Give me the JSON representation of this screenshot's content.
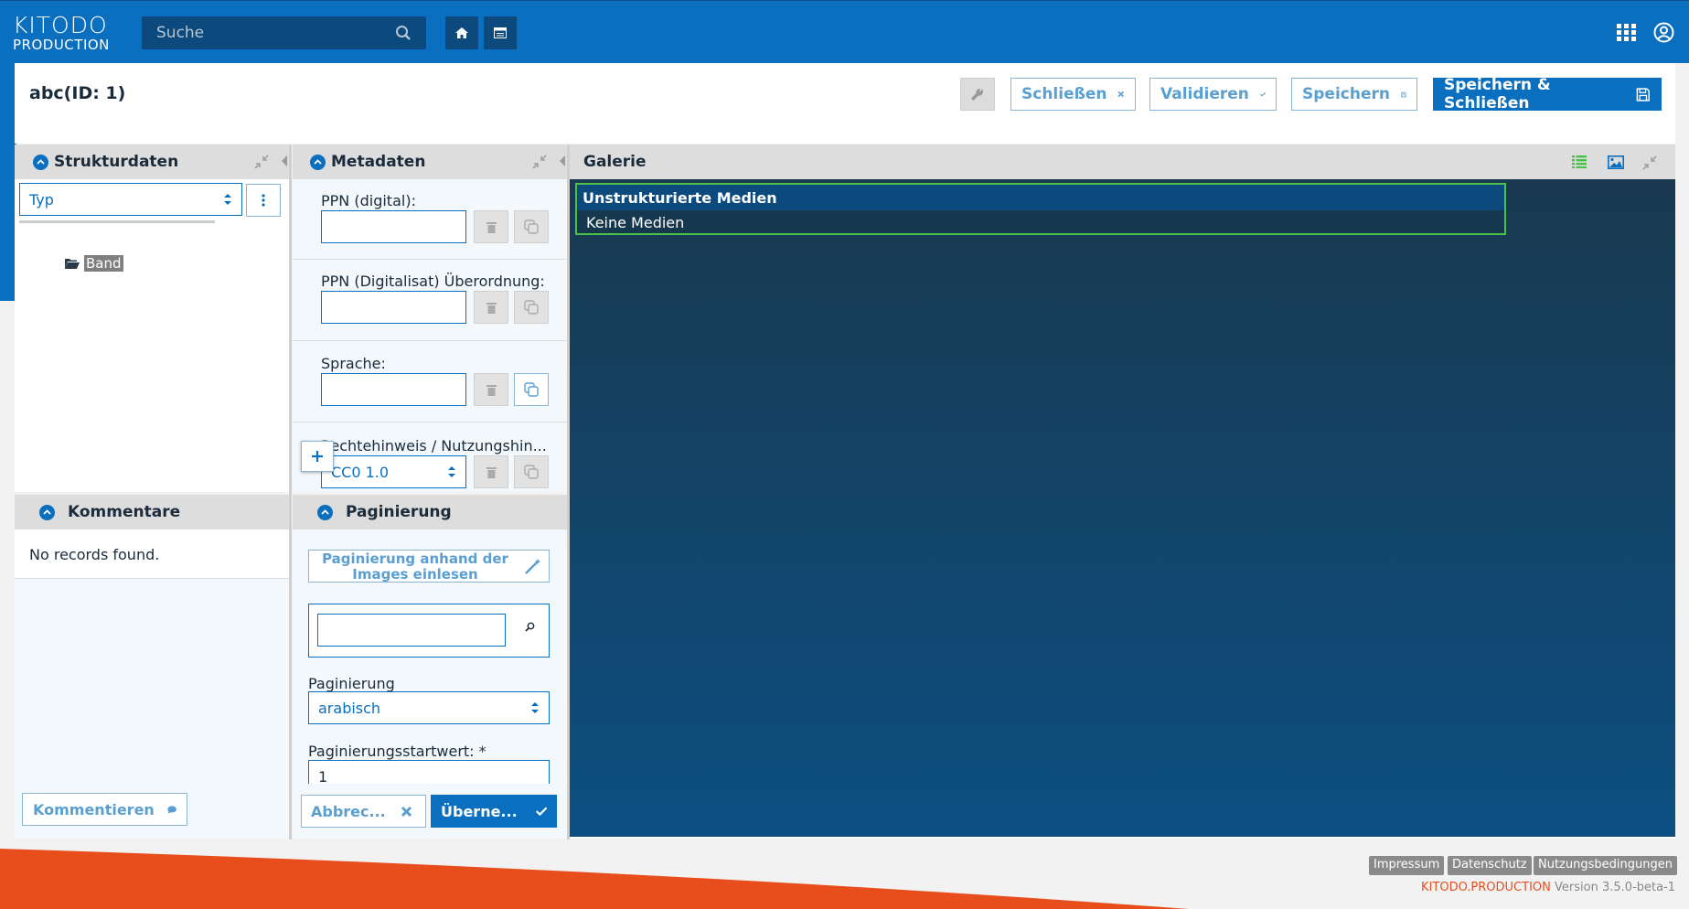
{
  "logo": {
    "line1": "KITODO",
    "line2": "PRODUCTION"
  },
  "search": {
    "placeholder": "Suche"
  },
  "header": {
    "title": "abc(ID: 1)",
    "close_label": "Schließen",
    "validate_label": "Validieren",
    "save_label": "Speichern",
    "save_close_label": "Speichern & Schließen"
  },
  "structure": {
    "title": "Strukturdaten",
    "type_label": "Typ",
    "tree_node": "Band"
  },
  "metadata": {
    "title": "Metadaten",
    "fields": [
      {
        "label": "PPN (digital):",
        "value": ""
      },
      {
        "label": "PPN (Digitalisat) Überordnung:",
        "value": ""
      },
      {
        "label": "Sprache:",
        "value": ""
      },
      {
        "label": "Rechtehinweis / Nutzungshin...",
        "value": "CC0 1.0"
      }
    ]
  },
  "gallery": {
    "title": "Galerie",
    "section_title": "Unstrukturierte Medien",
    "empty_text": "Keine Medien"
  },
  "comments": {
    "title": "Kommentare",
    "empty": "No records found.",
    "add_label": "Kommentieren"
  },
  "pagination": {
    "title": "Paginierung",
    "from_images_label": "Paginierung anhand der Images einlesen",
    "search_value": "",
    "type_label": "Paginierung",
    "type_value": "arabisch",
    "start_label": "Paginierungsstartwert: *",
    "start_value": "1",
    "cancel_label": "Abbrec...",
    "apply_label": "Überne..."
  },
  "footer": {
    "links": [
      "Impressum",
      "Datenschutz",
      "Nutzungsbedingungen"
    ],
    "brand": "KITODO.PRODUCTION",
    "version": "Version 3.5.0-beta-1"
  },
  "colors": {
    "primary": "#0a6fbf",
    "dark": "#0c4a7d",
    "accent": "#e3501f",
    "highlight": "#4cc04c"
  }
}
